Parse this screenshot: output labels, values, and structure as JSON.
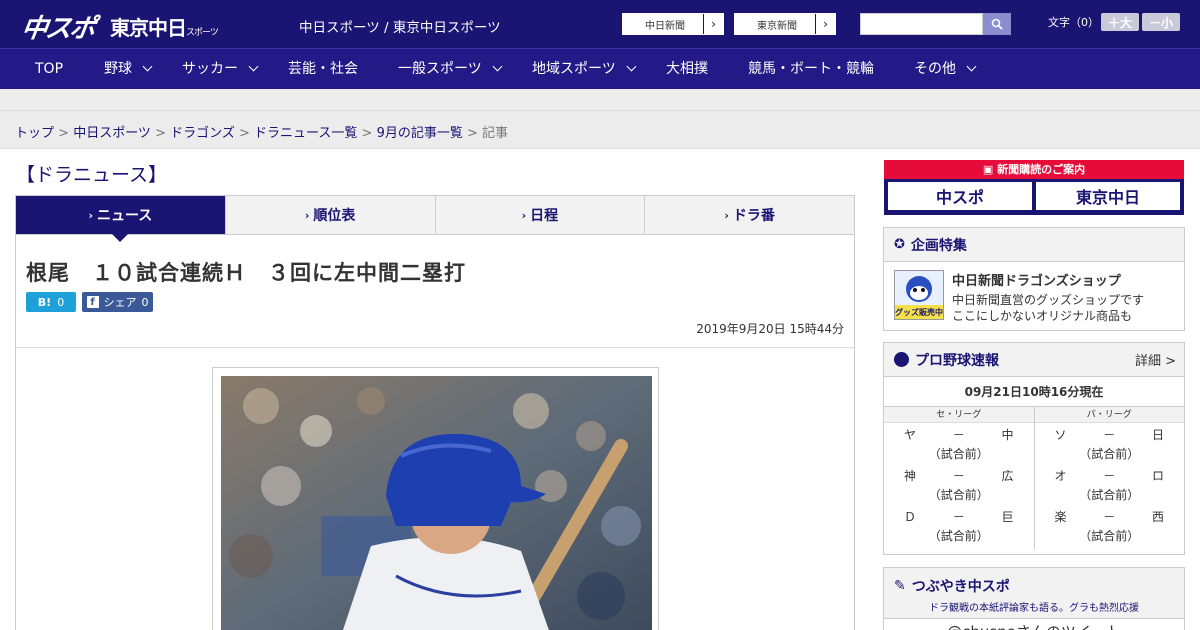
{
  "header": {
    "logo_chuspo": "中スポ",
    "logo_tokyo": "東京中日",
    "logo_tokyo_small": "スポーツ",
    "site_title": "中日スポーツ / 東京中日スポーツ",
    "link_chunichi": "中日新聞",
    "link_tokyo": "東京新聞",
    "search_placeholder": "",
    "font_size_label": "文字（0）",
    "font_bigger": "＋大",
    "font_smaller": "－小",
    "arrow": "›"
  },
  "nav": {
    "items": [
      {
        "label": "TOP"
      },
      {
        "label": "野球"
      },
      {
        "label": "サッカー"
      },
      {
        "label": "芸能・社会"
      },
      {
        "label": "一般スポーツ"
      },
      {
        "label": "地域スポーツ"
      },
      {
        "label": "大相撲"
      },
      {
        "label": "競馬・ボート・競輪"
      },
      {
        "label": "その他"
      }
    ]
  },
  "breadcrumb": {
    "items": [
      "トップ",
      "中日スポーツ",
      "ドラゴンズ",
      "ドラニュース一覧",
      "9月の記事一覧"
    ],
    "current": "記事",
    "sep": " > "
  },
  "section_title": "【ドラニュース】",
  "tabs": [
    {
      "label": "ニュース",
      "active": true
    },
    {
      "label": "順位表",
      "active": false
    },
    {
      "label": "日程",
      "active": false
    },
    {
      "label": "ドラ番",
      "active": false
    }
  ],
  "article": {
    "headline": "根尾　１０試合連続Ｈ　３回に左中間二塁打",
    "hatena_count": "0",
    "share_label": "シェア",
    "share_count": "0",
    "date": "2019年9月20日 15時44分"
  },
  "sidebar": {
    "subscribe_header": "新聞購読のご案内",
    "subscribe_logo1": "中スポ",
    "subscribe_logo2": "東京中日",
    "special_title": "企画特集",
    "shop_title": "中日新聞ドラゴンズショップ",
    "shop_desc1": "中日新聞直営のグッズショップです",
    "shop_desc2": "ここにしかないオリジナル商品も",
    "shop_img_label": "グッズ販売中",
    "scores_title": "プロ野球速報",
    "scores_more": "詳細 >",
    "scores_time": "09月21日10時16分現在",
    "central": {
      "name": "セ・リーグ",
      "games": [
        {
          "home": "ヤ",
          "away": "中",
          "score": "－",
          "status": "（試合前）"
        },
        {
          "home": "神",
          "away": "広",
          "score": "－",
          "status": "（試合前）"
        },
        {
          "home": "Ｄ",
          "away": "巨",
          "score": "－",
          "status": "（試合前）"
        }
      ]
    },
    "pacific": {
      "name": "パ・リーグ",
      "games": [
        {
          "home": "ソ",
          "away": "日",
          "score": "－",
          "status": "（試合前）"
        },
        {
          "home": "オ",
          "away": "ロ",
          "score": "－",
          "status": "（試合前）"
        },
        {
          "home": "楽",
          "away": "西",
          "score": "－",
          "status": "（試合前）"
        }
      ]
    },
    "tweet_title": "つぶやき中スポ",
    "tweet_sub": "ドラ観戦の本紙評論家も語る。グラも熱烈応援",
    "tweet_user": "@chuspoさんのツイート"
  },
  "colors": {
    "brand": "#1a1473",
    "nav": "#231a87",
    "accent_red": "#e60c3a",
    "hatena": "#1ea0d8",
    "facebook": "#3b5998"
  }
}
